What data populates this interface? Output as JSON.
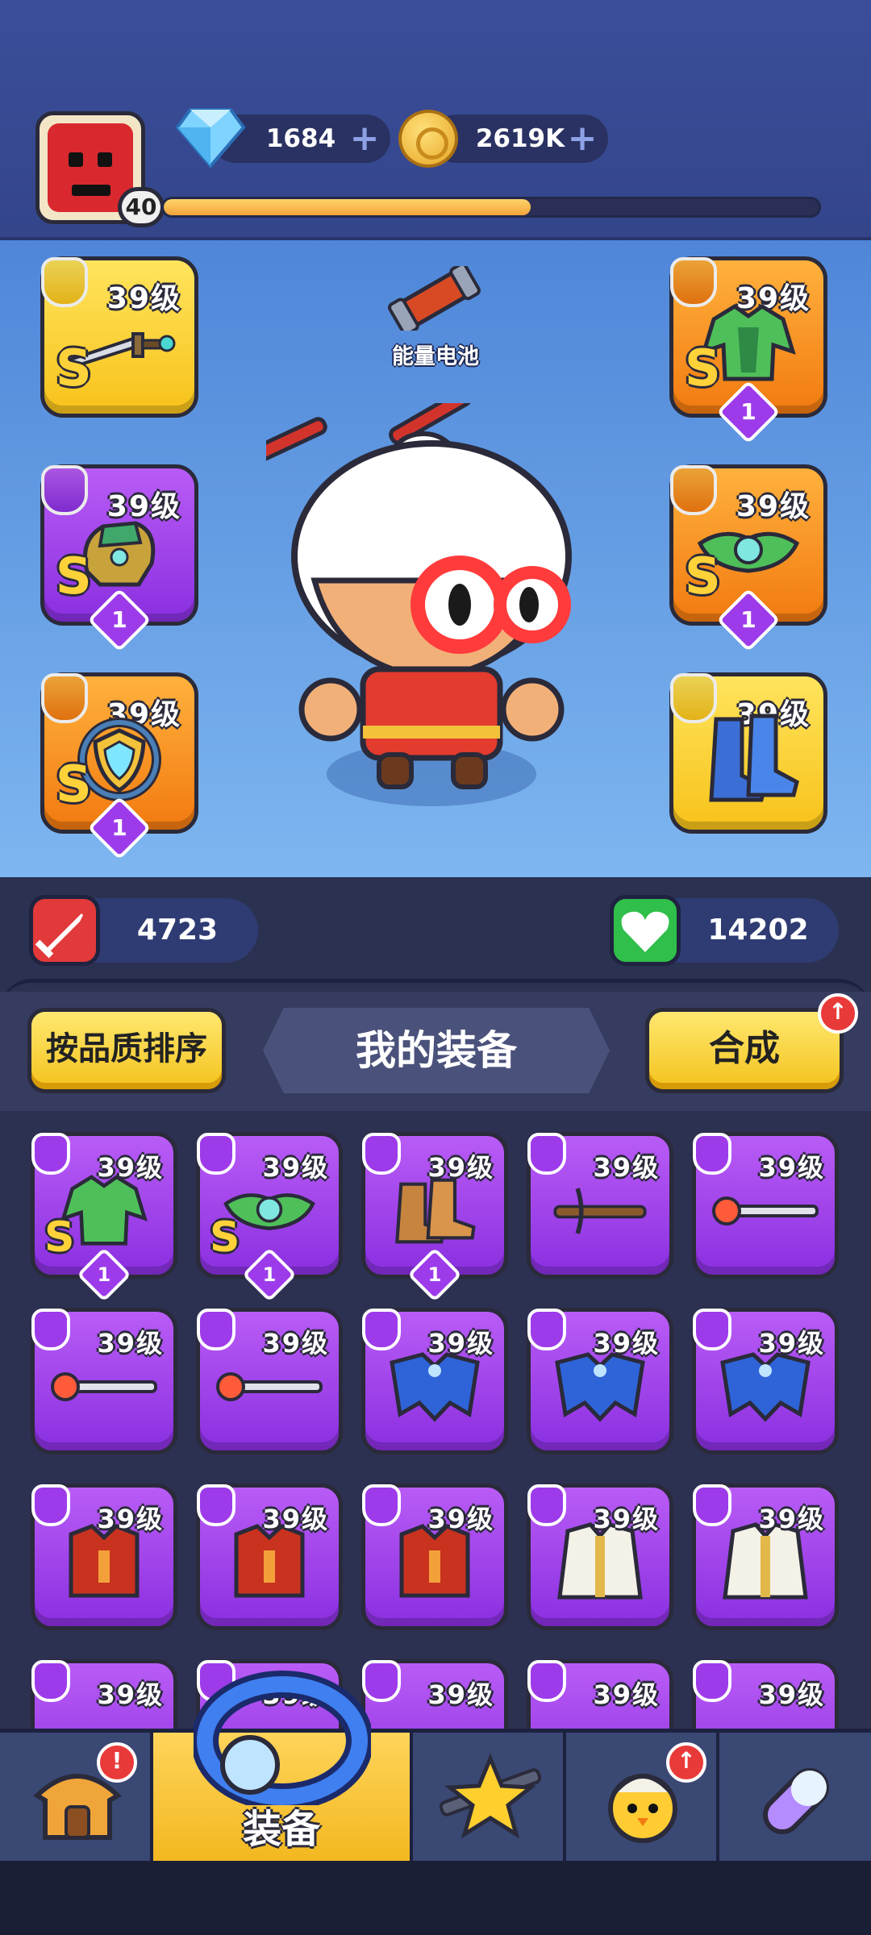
{
  "player": {
    "level": "40",
    "xp_fraction": 0.56
  },
  "currencies": {
    "gems": "1684",
    "coins": "2619K"
  },
  "center": {
    "battery_label": "能量电池"
  },
  "equipped": [
    {
      "level": "39级",
      "rank": "S",
      "star": ""
    },
    {
      "level": "39级",
      "rank": "S",
      "star": "1"
    },
    {
      "level": "39级",
      "rank": "S",
      "star": "1"
    },
    {
      "level": "39级",
      "rank": "S",
      "star": "1"
    },
    {
      "level": "39级",
      "rank": "S",
      "star": "1"
    },
    {
      "level": "39级",
      "rank": "",
      "star": ""
    }
  ],
  "stats": {
    "attack": "4723",
    "health": "14202"
  },
  "toolbar": {
    "sort_label": "按品质排序",
    "title": "我的装备",
    "merge_label": "合成"
  },
  "inventory": [
    {
      "level": "39级",
      "rank": "S",
      "star": "1"
    },
    {
      "level": "39级",
      "rank": "S",
      "star": "1"
    },
    {
      "level": "39级",
      "rank": "",
      "star": "1"
    },
    {
      "level": "39级",
      "rank": "",
      "star": ""
    },
    {
      "level": "39级",
      "rank": "",
      "star": ""
    },
    {
      "level": "39级",
      "rank": "",
      "star": ""
    },
    {
      "level": "39级",
      "rank": "",
      "star": ""
    },
    {
      "level": "39级",
      "rank": "",
      "star": ""
    },
    {
      "level": "39级",
      "rank": "",
      "star": ""
    },
    {
      "level": "39级",
      "rank": "",
      "star": ""
    },
    {
      "level": "39级",
      "rank": "",
      "star": ""
    },
    {
      "level": "39级",
      "rank": "",
      "star": ""
    },
    {
      "level": "39级",
      "rank": "",
      "star": ""
    },
    {
      "level": "39级",
      "rank": "",
      "star": ""
    },
    {
      "level": "39级",
      "rank": "",
      "star": ""
    },
    {
      "level": "39级",
      "rank": "",
      "star": ""
    },
    {
      "level": "39级",
      "rank": "",
      "star": ""
    },
    {
      "level": "39级",
      "rank": "",
      "star": ""
    },
    {
      "level": "39级",
      "rank": "",
      "star": ""
    },
    {
      "level": "39级",
      "rank": "",
      "star": ""
    }
  ],
  "nav": {
    "active_label": "装备",
    "home_alert": "!",
    "pets_alert": "↑"
  },
  "colors": {
    "purple": "#9d3bea",
    "gold": "#f7c21a",
    "orange": "#f27a10",
    "panel": "#2c3152"
  }
}
